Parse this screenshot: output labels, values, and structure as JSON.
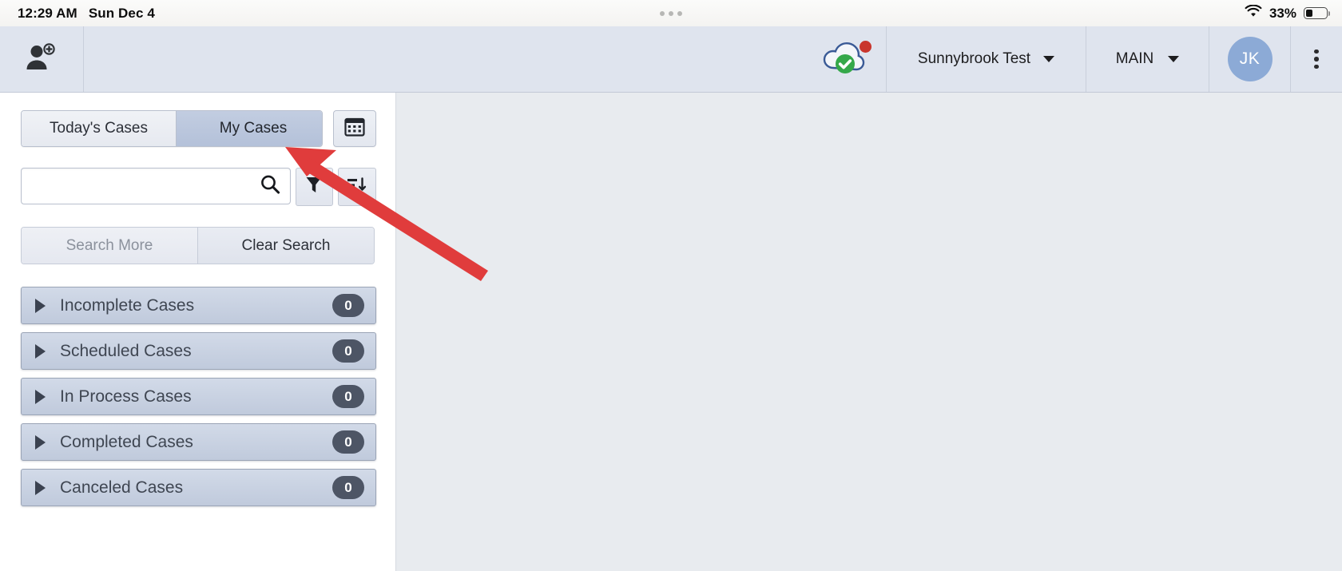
{
  "status_bar": {
    "time": "12:29 AM",
    "date": "Sun Dec 4",
    "battery_percent": "33%",
    "wifi_icon": "wifi-icon",
    "battery_icon": "battery-icon",
    "handle_icon": "multitask-dots-icon"
  },
  "header": {
    "add_person_icon": "add-person-icon",
    "cloud_icon": "cloud-sync-ok-icon",
    "notification_dot": "notification-dot",
    "org_name": "Sunnybrook Test",
    "location_name": "MAIN",
    "avatar_initials": "JK",
    "kebab_icon": "more-vertical-icon",
    "chevron_icon": "chevron-down-icon"
  },
  "sidebar": {
    "tabs": [
      {
        "label": "Today's Cases",
        "active": false
      },
      {
        "label": "My Cases",
        "active": true
      }
    ],
    "calendar_button_icon": "calendar-icon",
    "search": {
      "value": "",
      "placeholder": "",
      "search_icon": "search-icon",
      "filter_icon": "filter-funnel-icon",
      "sort_icon": "sort-icon"
    },
    "search_actions": [
      {
        "label": "Search More",
        "enabled": false
      },
      {
        "label": "Clear Search",
        "enabled": true
      }
    ],
    "case_groups": [
      {
        "label": "Incomplete Cases",
        "count": "0"
      },
      {
        "label": "Scheduled Cases",
        "count": "0"
      },
      {
        "label": "In Process Cases",
        "count": "0"
      },
      {
        "label": "Completed Cases",
        "count": "0"
      },
      {
        "label": "Canceled Cases",
        "count": "0"
      }
    ]
  },
  "annotation": {
    "arrow_color": "#e03c3c",
    "arrow_target": "my-cases-tab"
  },
  "colors": {
    "header_bg": "#dfe4ee",
    "content_bg": "#e8ebef",
    "accent_blue": "#8caad6",
    "badge_bg": "#4d5565",
    "notification_red": "#c9352c",
    "cloud_green": "#35a84a"
  }
}
